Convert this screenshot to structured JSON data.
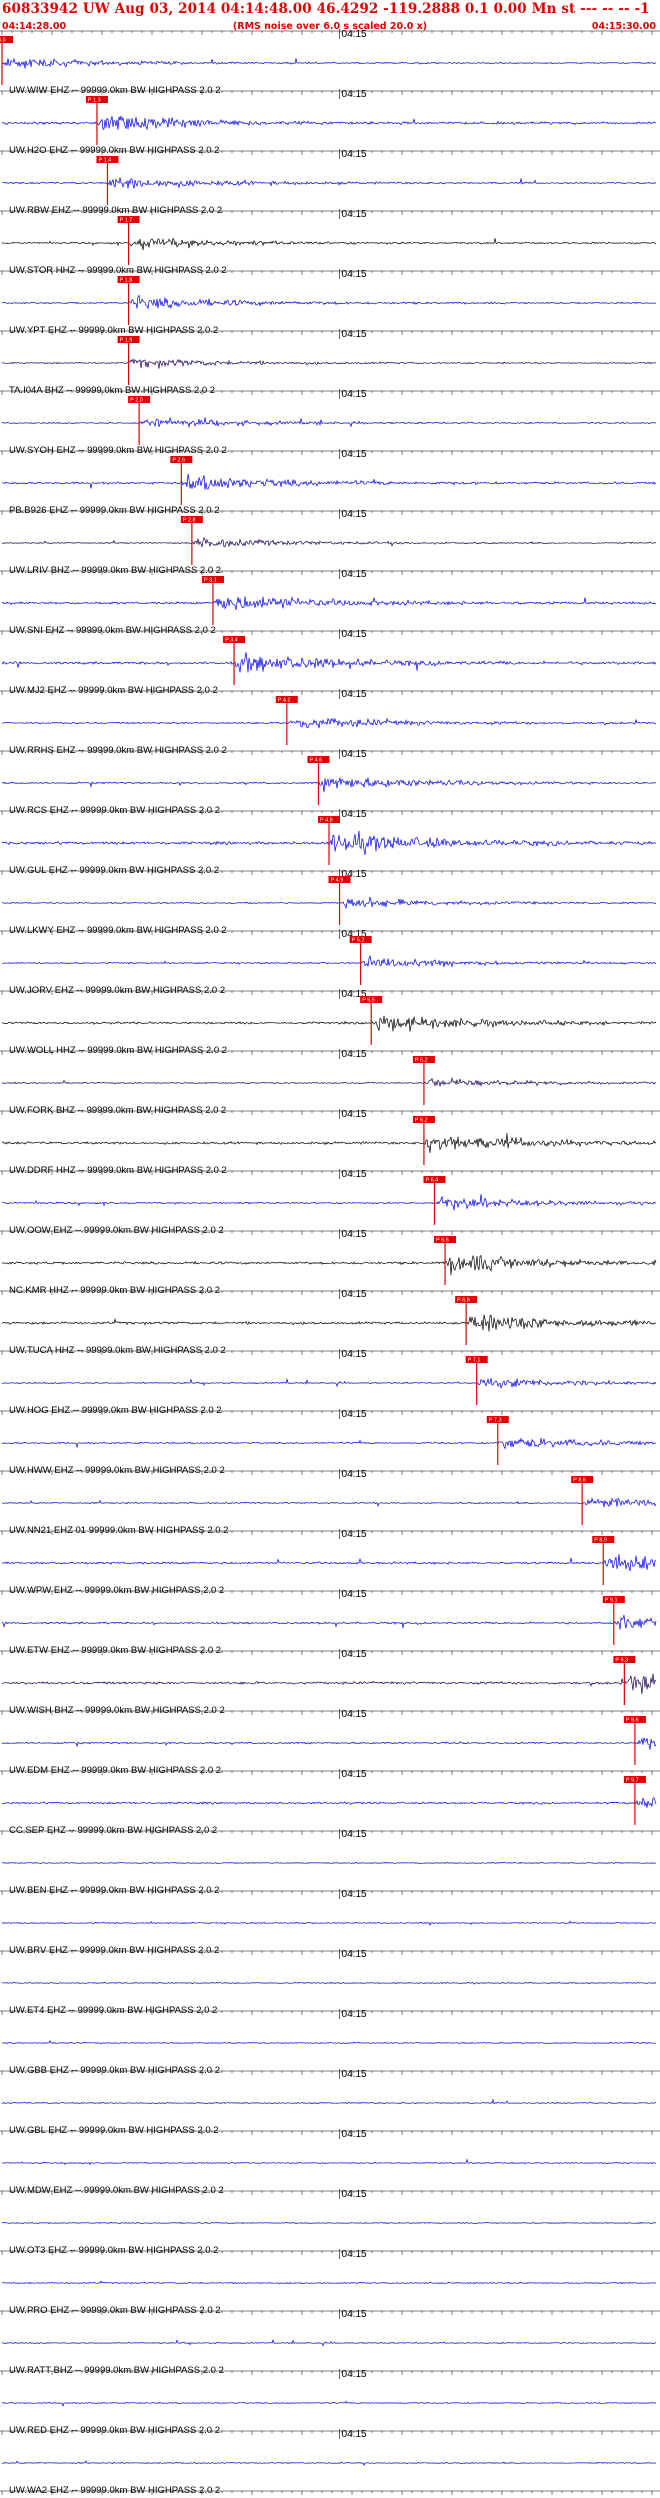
{
  "header": {
    "title": "60833942 UW Aug 03, 2014 04:14:48.00   46.4292 -119.2888  0.1 0.00 Mn st --- -- --  -1",
    "subtitle": "(RMS noise over 6.0 s scaled 20.0 x)",
    "start_time": "04:14:28.00",
    "end_time": "04:15:30.00"
  },
  "colors": {
    "title": "#e00000",
    "pick": "#e00000",
    "trace_blue": "#0000ee",
    "trace_dark": "#1a0050",
    "trace_black": "#000000",
    "grid": "#000000"
  },
  "chart_data": {
    "type": "line",
    "title": "60833942 UW Aug 03, 2014 04:14:48.00   46.4292 -119.2888  0.1 0.00 Mn st --- -- --  -1",
    "x_label_minute": "04:15",
    "x_range": [
      "04:14:28.00",
      "04:15:30.00"
    ],
    "series": [
      {
        "label": "UW.WIW EHZ -- 99999.0km BW  HIGHPASS  2.0  2",
        "color": "blue",
        "pick": "04:14:28",
        "pick_label": "P 0.0",
        "amp": 0.5
      },
      {
        "label": "UW.H2O EHZ -- 99999.0km BW  HIGHPASS  2.0  2",
        "color": "blue",
        "pick": "04:14:37",
        "pick_label": "P 1.3",
        "amp": 0.8
      },
      {
        "label": "UW.RBW EHZ -- 99999.0km BW  HIGHPASS  2.0  2",
        "color": "blue",
        "pick": "04:14:38",
        "pick_label": "P 1.4",
        "amp": 0.6
      },
      {
        "label": "UW.STOR HHZ -- 99999.0km BW  HIGHPASS  2.0  2",
        "color": "black",
        "pick": "04:14:40",
        "pick_label": "P 1.7",
        "amp": 0.55
      },
      {
        "label": "UW.YPT EHZ -- 99999.0km BW  HIGHPASS  2.0  2",
        "color": "blue",
        "pick": "04:14:40",
        "pick_label": "P 1.8",
        "amp": 0.6
      },
      {
        "label": "TA.I04A BHZ -- 99999.0km BW  HIGHPASS  2.0  2",
        "color": "dark",
        "pick": "04:14:40",
        "pick_label": "P 1.9",
        "amp": 0.45
      },
      {
        "label": "UW.SYOH EHZ -- 99999.0km BW  HIGHPASS  2.0  2",
        "color": "blue",
        "pick": "04:14:41",
        "pick_label": "P 2.0",
        "amp": 0.5
      },
      {
        "label": "PB.B926 EHZ -- 99999.0km BW  HIGHPASS  2.0  2",
        "color": "blue",
        "pick": "04:14:45",
        "pick_label": "P 2.6",
        "amp": 0.75
      },
      {
        "label": "UW.LRIV BHZ -- 99999.0km BW  HIGHPASS  2.0  2",
        "color": "dark",
        "pick": "04:14:46",
        "pick_label": "P 2.8",
        "amp": 0.45
      },
      {
        "label": "UW.SNI EHZ -- 99999.0km BW  HIGHPASS  2.0  2",
        "color": "blue",
        "pick": "04:14:48",
        "pick_label": "P 3.1",
        "amp": 0.85
      },
      {
        "label": "UW.MJ2 EHZ -- 99999.0km BW  HIGHPASS  2.0  2",
        "color": "blue",
        "pick": "04:14:50",
        "pick_label": "P 3.4",
        "amp": 0.9
      },
      {
        "label": "UW.RRHS EHZ -- 99999.0km BW  HIGHPASS  2.0  2",
        "color": "blue",
        "pick": "04:14:55",
        "pick_label": "P 4.2",
        "amp": 0.6
      },
      {
        "label": "UW.RCS EHZ -- 99999.0km BW  HIGHPASS  2.0  2",
        "color": "blue",
        "pick": "04:14:58",
        "pick_label": "P 4.6",
        "amp": 0.65
      },
      {
        "label": "UW.GUL EHZ -- 99999.0km BW  HIGHPASS  2.0  2",
        "color": "blue",
        "pick": "04:14:59",
        "pick_label": "P 4.8",
        "amp": 1.0
      },
      {
        "label": "UW.LKWY EHZ -- 99999.0km BW  HIGHPASS  2.0  2",
        "color": "blue",
        "pick": "04:15:00",
        "pick_label": "P 4.9",
        "amp": 0.5
      },
      {
        "label": "UW.JORV EHZ -- 99999.0km BW  HIGHPASS  2.0  2",
        "color": "blue",
        "pick": "04:15:02",
        "pick_label": "P 5.2",
        "amp": 0.5
      },
      {
        "label": "UW.WOLL HHZ -- 99999.0km BW  HIGHPASS  2.0  2",
        "color": "black",
        "pick": "04:15:03",
        "pick_label": "P 5.5",
        "amp": 0.8
      },
      {
        "label": "UW.FORK BHZ -- 99999.0km BW  HIGHPASS  2.0  2",
        "color": "dark",
        "pick": "04:15:08",
        "pick_label": "P 6.2",
        "amp": 0.45
      },
      {
        "label": "UW.DDRF HHZ -- 99999.0km BW  HIGHPASS  2.0  2",
        "color": "black",
        "pick": "04:15:08",
        "pick_label": "P 6.2",
        "amp": 0.9
      },
      {
        "label": "UW.OOW EHZ -- 99999.0km BW  HIGHPASS  2.0  2",
        "color": "blue",
        "pick": "04:15:09",
        "pick_label": "P 6.4",
        "amp": 0.6
      },
      {
        "label": "NC.KMR HHZ -- 99999.0km BW  HIGHPASS  2.0  2",
        "color": "black",
        "pick": "04:15:10",
        "pick_label": "P 6.6",
        "amp": 0.9
      },
      {
        "label": "UW.TUCA HHZ -- 99999.0km BW  HIGHPASS  2.0  2",
        "color": "black",
        "pick": "04:15:12",
        "pick_label": "P 6.8",
        "amp": 0.9
      },
      {
        "label": "UW.HOG EHZ -- 99999.0km BW  HIGHPASS  2.0  2",
        "color": "blue",
        "pick": "04:15:13",
        "pick_label": "P 7.1",
        "amp": 0.5
      },
      {
        "label": "UW.HWW EHZ -- 99999.0km BW  HIGHPASS  2.0  2",
        "color": "blue",
        "pick": "04:15:15",
        "pick_label": "P 7.3",
        "amp": 0.55
      },
      {
        "label": "UW.NN21 EHZ 01 99999.0km BW  HIGHPASS  2.0  2",
        "color": "blue",
        "pick": "04:15:23",
        "pick_label": "P 8.6",
        "amp": 0.5
      },
      {
        "label": "UW.WPW EHZ -- 99999.0km BW  HIGHPASS  2.0  2",
        "color": "blue",
        "pick": "04:15:25",
        "pick_label": "P 8.9",
        "amp": 0.8
      },
      {
        "label": "UW.ETW EHZ -- 99999.0km BW  HIGHPASS  2.0  2",
        "color": "blue",
        "pick": "04:15:26",
        "pick_label": "P 9.1",
        "amp": 0.7
      },
      {
        "label": "UW.WISH BHZ -- 99999.0km BW  HIGHPASS  2.0  2",
        "color": "dark",
        "pick": "04:15:27",
        "pick_label": "P 9.3",
        "amp": 0.9
      },
      {
        "label": "UW.EDM EHZ -- 99999.0km BW  HIGHPASS  2.0  2",
        "color": "blue",
        "pick": "04:15:28",
        "pick_label": "P 9.6",
        "amp": 0.6
      },
      {
        "label": "CC.SEP EHZ -- 99999.0km BW  HIGHPASS  2.0  2",
        "color": "blue",
        "pick": "04:15:28",
        "pick_label": "P 9.7",
        "amp": 0.7
      },
      {
        "label": "UW.BEN EHZ -- 99999.0km BW  HIGHPASS  2.0  2",
        "color": "blue",
        "amp": 0.4
      },
      {
        "label": "UW.BRV EHZ -- 99999.0km BW  HIGHPASS  2.0  2",
        "color": "blue",
        "amp": 0.4
      },
      {
        "label": "UW.ET4 EHZ -- 99999.0km BW  HIGHPASS  2.0  2",
        "color": "blue",
        "amp": 0.4
      },
      {
        "label": "UW.GBB EHZ -- 99999.0km BW  HIGHPASS  2.0  2",
        "color": "blue",
        "amp": 0.4
      },
      {
        "label": "UW.GBL EHZ -- 99999.0km BW  HIGHPASS  2.0  2",
        "color": "blue",
        "amp": 0.45
      },
      {
        "label": "UW.MDW EHZ -- 99999.0km BW  HIGHPASS  2.0  2",
        "color": "blue",
        "amp": 0.4
      },
      {
        "label": "UW.OT3 EHZ -- 99999.0km BW  HIGHPASS  2.0  2",
        "color": "blue",
        "amp": 0.4
      },
      {
        "label": "UW.PRO EHZ -- 99999.0km BW  HIGHPASS  2.0  2",
        "color": "blue",
        "amp": 0.45
      },
      {
        "label": "UW.RATT BHZ -- 99999.0km BW  HIGHPASS  2.0  2",
        "color": "blue",
        "amp": 0.4
      },
      {
        "label": "UW.RED EHZ -- 99999.0km BW  HIGHPASS  2.0  2",
        "color": "blue",
        "amp": 0.4
      },
      {
        "label": "UW.WA2 EHZ -- 99999.0km BW  HIGHPASS  2.0  2",
        "color": "blue",
        "amp": 0.4
      }
    ]
  }
}
